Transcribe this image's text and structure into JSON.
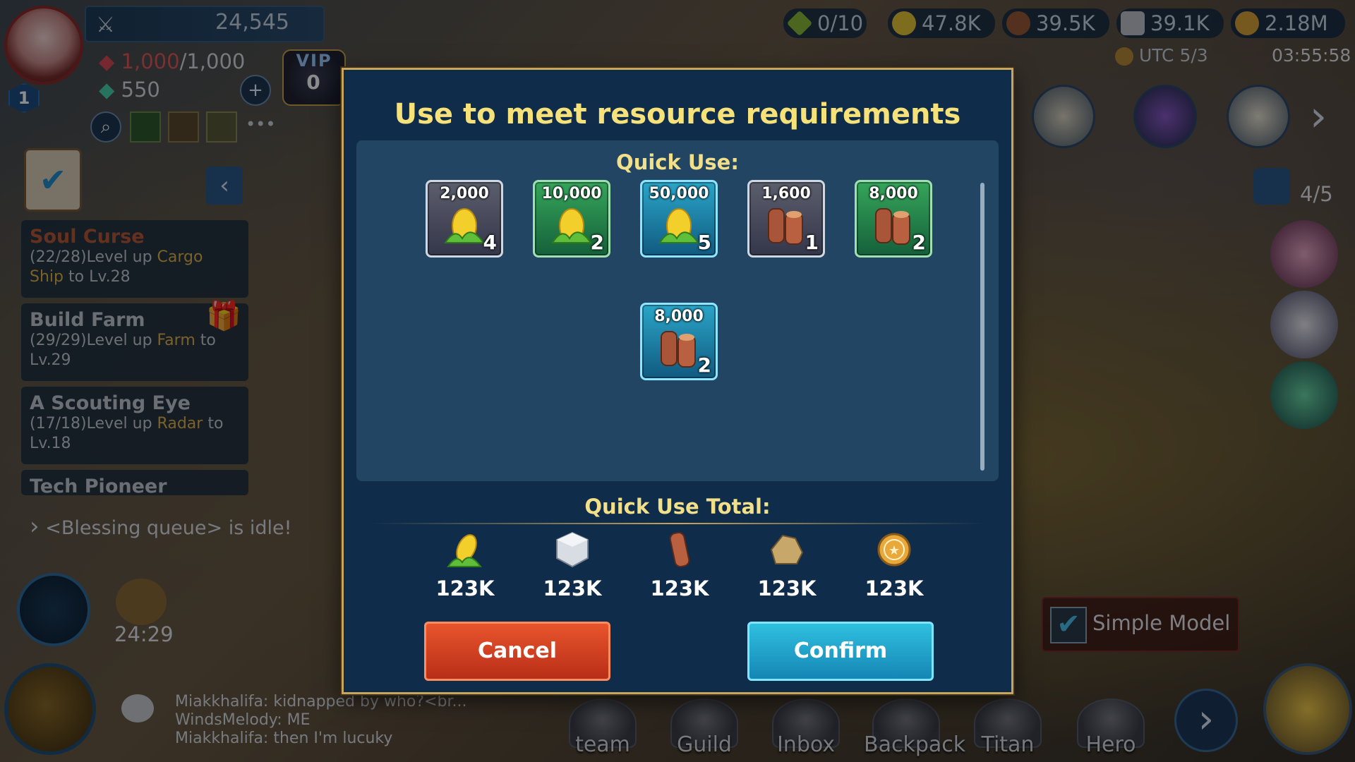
{
  "player": {
    "level": "1",
    "power": "24,545",
    "energy_current": "1,000",
    "energy_max": "/1,000",
    "gems": "550",
    "vip_label": "VIP",
    "vip_level": "0"
  },
  "top_resources": {
    "stamina": "0/10",
    "food": "47.8K",
    "wood": "39.5K",
    "stone": "39.1K",
    "gold": "2.18M",
    "server_time_label": "UTC 5/3",
    "clock": "03:55:58"
  },
  "right_panel": {
    "hero_count": "4/5"
  },
  "quests": [
    {
      "title": "Soul Curse",
      "progress": "(22/28)",
      "pre": "Level up ",
      "target": "Cargo Ship",
      "post": " to Lv.28"
    },
    {
      "title": "Build Farm",
      "progress": "(29/29)",
      "pre": "Level up ",
      "target": "Farm",
      "post": " to Lv.29"
    },
    {
      "title": "A Scouting Eye",
      "progress": "(17/18)",
      "pre": "Level up ",
      "target": "Radar",
      "post": " to Lv.18"
    },
    {
      "title": "Tech Pioneer"
    }
  ],
  "blessing_status": "<Blessing queue> is idle!",
  "timer": "24:29",
  "simple_model_label": "Simple Model",
  "chat": [
    "Miakkhalifa: kidnapped by who?<br...",
    "WindsMelody: ME",
    "Miakkhalifa: then I'm lucuky"
  ],
  "nav": [
    "team",
    "Guild",
    "Inbox",
    "Backpack",
    "Titan",
    "Hero"
  ],
  "dialog": {
    "title": "Use to meet resource requirements",
    "quick_use_label": "Quick Use:",
    "items": [
      {
        "amount": "2,000",
        "count": "4",
        "type": "corn",
        "rarity": "gray"
      },
      {
        "amount": "10,000",
        "count": "2",
        "type": "corn",
        "rarity": "green"
      },
      {
        "amount": "50,000",
        "count": "5",
        "type": "corn",
        "rarity": "blue"
      },
      {
        "amount": "1,600",
        "count": "1",
        "type": "wood",
        "rarity": "gray"
      },
      {
        "amount": "8,000",
        "count": "2",
        "type": "wood",
        "rarity": "green"
      },
      {
        "amount": "8,000",
        "count": "2",
        "type": "wood",
        "rarity": "blue"
      }
    ],
    "total_label": "Quick Use Total:",
    "totals": [
      {
        "icon": "corn-icon",
        "value": "123K"
      },
      {
        "icon": "stone-icon",
        "value": "123K"
      },
      {
        "icon": "wood-icon",
        "value": "123K"
      },
      {
        "icon": "ore-icon",
        "value": "123K"
      },
      {
        "icon": "gold-coin-icon",
        "value": "123K"
      }
    ],
    "cancel_label": "Cancel",
    "confirm_label": "Confirm"
  },
  "colors": {
    "dialog_bg": "#0f2d4b",
    "dialog_border": "#c8a55a",
    "title": "#f7e27a",
    "cancel": "#d1401f",
    "confirm": "#1fa6cf"
  }
}
